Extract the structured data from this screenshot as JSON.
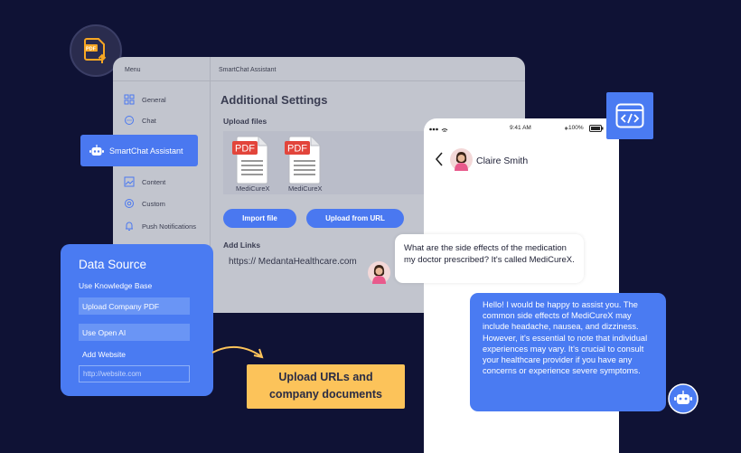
{
  "pdf_badge": {
    "text": "PDF"
  },
  "window": {
    "menu_title": "Menu",
    "app_title": "SmartChat Assistant",
    "menu_items": [
      {
        "label": "General",
        "icon": "grid-icon"
      },
      {
        "label": "Chat",
        "icon": "chat-icon"
      },
      {
        "label": "Content",
        "icon": "content-icon"
      },
      {
        "label": "Custom",
        "icon": "custom-icon"
      },
      {
        "label": "Push Notifications",
        "icon": "bell-icon"
      }
    ],
    "settings_title": "Additional Settings",
    "upload_label": "Upload files",
    "files": [
      {
        "badge": "PDF",
        "name": "MediCureX"
      },
      {
        "badge": "PDF",
        "name": "MediCureX"
      }
    ],
    "import_button": "Import file",
    "upload_url_button": "Upload from URL",
    "links_label": "Add Links",
    "link_value": "https:// MedantaHealthcare.com"
  },
  "smartchat_pill": {
    "label": "SmartChat Assistant"
  },
  "data_source": {
    "title": "Data Source",
    "knowledge_base": "Use Knowledge Base",
    "upload_pdf": "Upload Company PDF",
    "use_openai": "Use Open AI",
    "add_website": "Add Website",
    "website_placeholder": "http://website.com"
  },
  "callout": {
    "line1": "Upload URLs and",
    "line2": "company documents"
  },
  "phone": {
    "time": "9:41 AM",
    "battery": "100%",
    "contact_name": "Claire Smith"
  },
  "chat": {
    "user_message": "What are the side effects of the medication my doctor prescribed? It's called MediCureX.",
    "bot_message": "Hello! I would be happy to assist you. The common side effects of MediCureX may include headache, nausea, and dizziness. However, it's essential to note that individual experiences may vary. It's crucial to consult your healthcare provider if you have any concerns or experience severe symptoms."
  },
  "colors": {
    "background": "#0f1235",
    "accent_blue": "#4a78f0",
    "callout_orange": "#fcc35a"
  }
}
